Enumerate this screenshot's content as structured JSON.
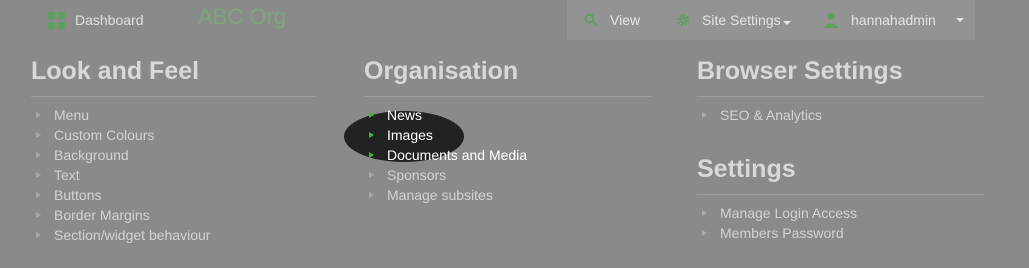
{
  "topbar": {
    "dashboard_label": "Dashboard",
    "brand": "ABC Org",
    "view_label": "View",
    "site_settings_label": "Site Settings",
    "user_label": "hannahadmin"
  },
  "columns": {
    "look": {
      "heading": "Look and Feel",
      "items": [
        "Menu",
        "Custom Colours",
        "Background",
        "Text",
        "Buttons",
        "Border Margins",
        "Section/widget behaviour"
      ]
    },
    "organisation": {
      "heading": "Organisation",
      "items": [
        "News",
        "Images",
        "Documents and Media",
        "Sponsors",
        "Manage subsites"
      ]
    },
    "browser": {
      "heading": "Browser Settings",
      "items": [
        "SEO & Analytics"
      ]
    },
    "settings": {
      "heading": "Settings",
      "items": [
        "Manage Login Access",
        "Members Password"
      ]
    }
  },
  "icons": {
    "dashboard": "grid-icon",
    "view": "search-icon",
    "site_settings": "gear-icon",
    "user": "user-icon"
  },
  "colors": {
    "overlay": "#8a8a8a",
    "accent": "#3fb83f",
    "spotlight": "#222222"
  }
}
